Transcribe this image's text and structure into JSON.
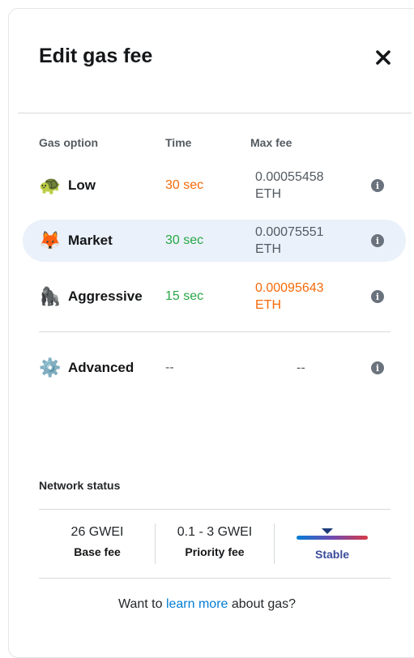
{
  "header": {
    "title": "Edit gas fee"
  },
  "columns": {
    "option": "Gas option",
    "time": "Time",
    "max_fee": "Max fee"
  },
  "options": [
    {
      "icon": "🐢",
      "label": "Low",
      "time": "30 sec",
      "fee_amount": "0.00055458",
      "fee_unit": "ETH",
      "time_color": "#f66a0a",
      "fee_color": "#535a61"
    },
    {
      "icon": "🦊",
      "label": "Market",
      "time": "30 sec",
      "fee_amount": "0.00075551",
      "fee_unit": "ETH",
      "time_color": "#28a745",
      "fee_color": "#535a61"
    },
    {
      "icon": "🦍",
      "label": "Aggressive",
      "time": "15 sec",
      "fee_amount": "0.00095643",
      "fee_unit": "ETH",
      "time_color": "#28a745",
      "fee_color": "#f66a0a"
    },
    {
      "icon": "⚙️",
      "label": "Advanced",
      "time": "--",
      "fee_amount": "--",
      "fee_unit": "",
      "time_color": "#535a61",
      "fee_color": "#535a61"
    }
  ],
  "network": {
    "title": "Network status",
    "base_fee_value": "26 GWEI",
    "base_fee_label": "Base fee",
    "priority_fee_value": "0.1 - 3 GWEI",
    "priority_fee_label": "Priority fee",
    "status": "Stable"
  },
  "footer": {
    "prefix": "Want to ",
    "link": "learn more",
    "suffix": " about gas?"
  }
}
